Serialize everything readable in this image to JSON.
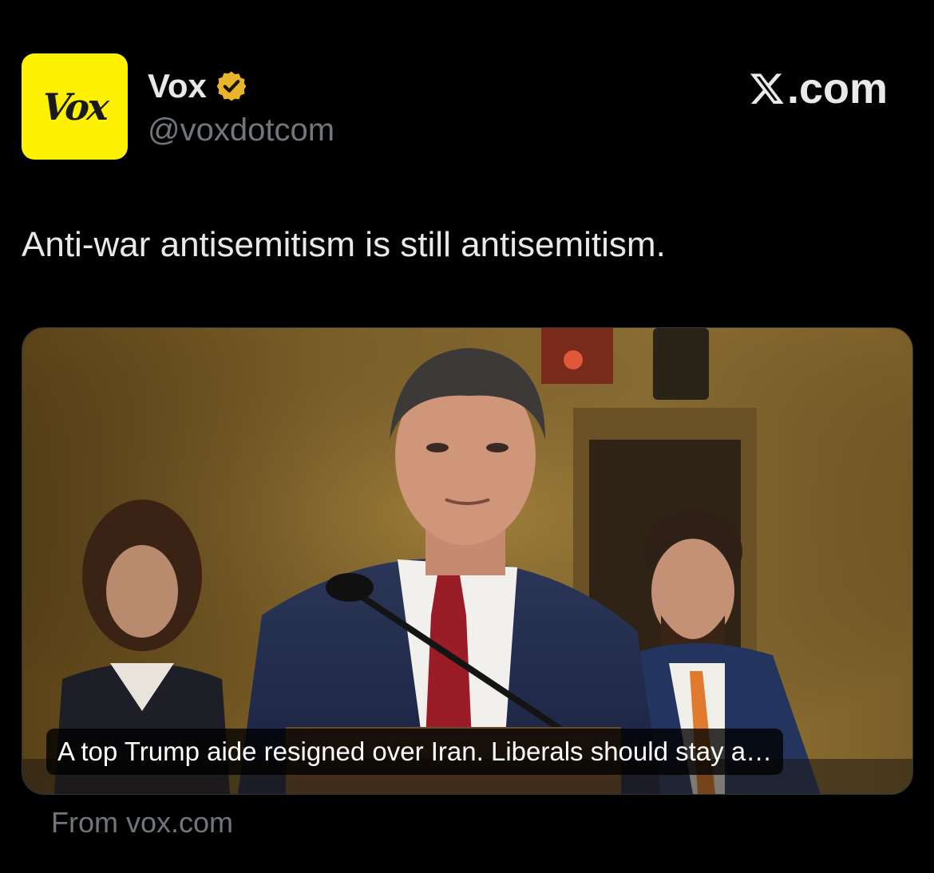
{
  "account": {
    "avatar_text": "Vox",
    "name": "Vox",
    "handle": "@voxdotcom",
    "verified_icon": "verified-gold-badge-icon"
  },
  "brand": {
    "label": ".com",
    "icon": "x-logo-icon"
  },
  "tweet": {
    "text": "Anti-war antisemitism is still antisemitism."
  },
  "card": {
    "caption": "A top Trump aide resigned over Iran. Liberals should stay a…",
    "source": "From vox.com"
  },
  "colors": {
    "background": "#000000",
    "text": "#e7e9ea",
    "muted": "#71767b",
    "avatar": "#fff200",
    "badge": "#e8b52a"
  }
}
